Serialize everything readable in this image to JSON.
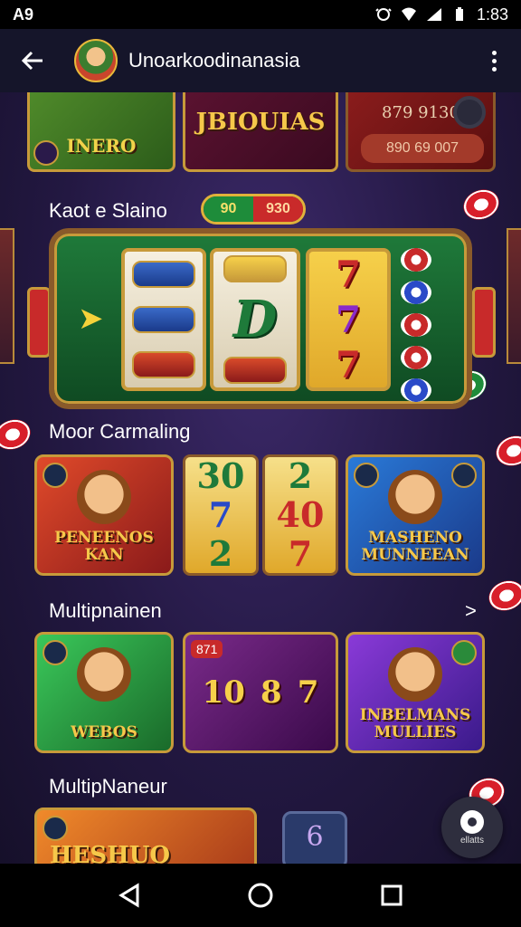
{
  "status_bar": {
    "left_label": "A9",
    "time": "1:83"
  },
  "app_bar": {
    "title": "Unoarkoodinanasia"
  },
  "top_row": {
    "tile1_label": "INERO",
    "tile2_label": "JBIOUIAS",
    "tile3_top": "879 9130",
    "tile3_bottom": "890 69 007"
  },
  "featured": {
    "title": "Kaot e Slaino",
    "pill_left": "90",
    "pill_right": "930"
  },
  "rows": [
    {
      "title": "Moor Carmaling",
      "show_arrow": false,
      "cards": [
        {
          "kind": "game",
          "title": "PENEENOS KAN",
          "bg": "#c42a2a"
        },
        {
          "kind": "reels",
          "symbols": [
            "30",
            "7",
            "2"
          ],
          "colors": [
            "#1e7a3a",
            "#2a4ac8",
            "#1e7a3a"
          ]
        },
        {
          "kind": "reels",
          "symbols": [
            "2",
            "40",
            "7"
          ],
          "colors": [
            "#1e7a3a",
            "#c82a2a",
            "#c82a2a"
          ]
        },
        {
          "kind": "game",
          "title": "MASHENO MUNNEEAN",
          "bg": "#2a6ac8"
        }
      ]
    },
    {
      "title": "Multipnainen",
      "arrow": ">",
      "cards": [
        {
          "kind": "game",
          "title": "WEBOS",
          "bg": "#2a9a4a"
        },
        {
          "kind": "slot",
          "symbols": [
            "10",
            "8",
            "7"
          ],
          "top": "871",
          "bg": "#5a1a6a"
        },
        {
          "kind": "game",
          "title": "INBELMANS MULLIES",
          "bg": "#6a2ac8"
        }
      ]
    },
    {
      "title": "MultipNaneur",
      "cards": [
        {
          "kind": "game",
          "title": "HESHUO",
          "bg": "#e07a2a"
        },
        {
          "kind": "small",
          "title": "6",
          "bg": "#2a3a6a"
        }
      ]
    }
  ],
  "fab": {
    "label": "ellatts"
  },
  "nav": {
    "back": "back-triangle",
    "home": "home-circle",
    "recents": "recents-square"
  }
}
